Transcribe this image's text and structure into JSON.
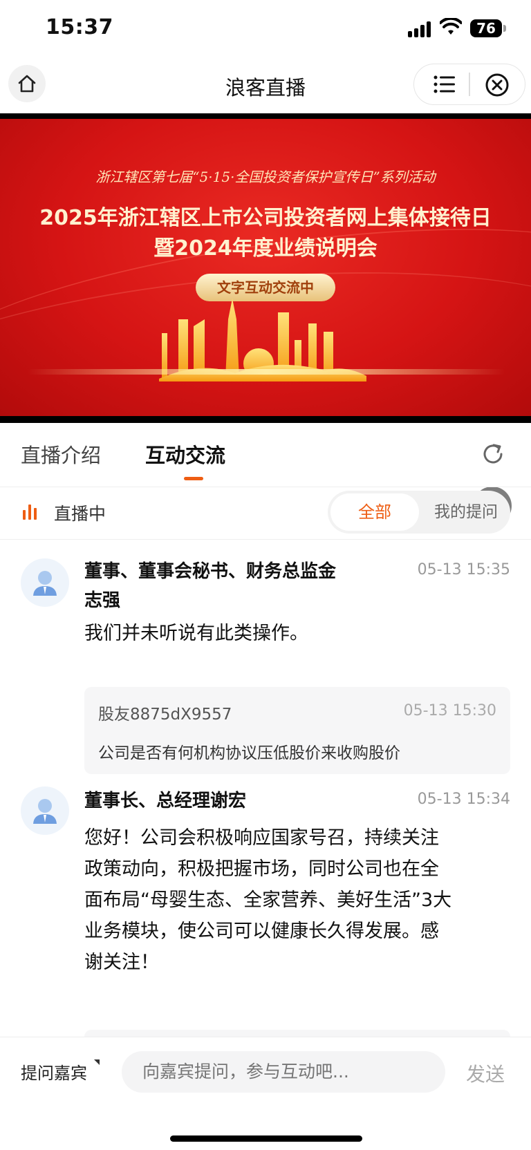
{
  "status_bar": {
    "time": "15:37",
    "battery": "76"
  },
  "nav": {
    "title": "浪客直播"
  },
  "banner": {
    "subtitle": "浙江辖区第七届“5·15·全国投资者保护宣传日”系列活动",
    "title_line1": "2025年浙江辖区上市公司投资者网上集体接待日",
    "title_line2": "暨2024年度业绩说明会",
    "badge": "文字互动交流中"
  },
  "tabs": [
    {
      "label": "直播介绍"
    },
    {
      "label": "互动交流"
    }
  ],
  "filter": {
    "live_label": "直播中",
    "all_label": "全部",
    "mine_label": "我的提问"
  },
  "feed": [
    {
      "author": "董事、董事会秘书、财务总监金",
      "author_line2": "志强",
      "time": "05-13 15:35",
      "answer": "我们并未听说有此类操作。",
      "question": {
        "user": "股友8875dX9557",
        "time": "05-13 15:30",
        "text": "公司是否有何机构协议压低股价来收购股价"
      }
    },
    {
      "author": "董事长、总经理谢宏",
      "time": "05-13 15:34",
      "answer_lines": [
        "您好！公司会积极响应国家号召，持续关注",
        "政策动向，积极把握市场，同时公司也在全",
        "面布局“母婴生态、全家营养、美好生活”3大",
        "业务模块，使公司可以健康长久得发展。感",
        "谢关注！"
      ]
    }
  ],
  "bottom": {
    "ask_guest_label": "提问嘉宾",
    "input_placeholder": "向嘉宾提问，参与互动吧...",
    "send_label": "发送"
  },
  "colors": {
    "accent": "#ee5d13",
    "banner_red": "#d51414",
    "gold": "#ffc42e"
  }
}
